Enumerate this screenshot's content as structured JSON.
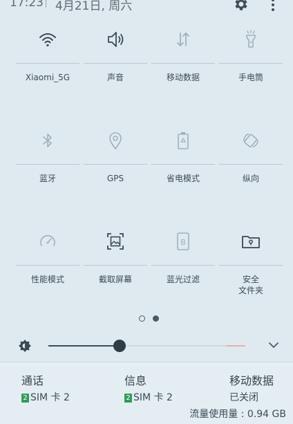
{
  "status_bar": {
    "time": "17:23",
    "date": "4月21日, 周六"
  },
  "tiles": [
    {
      "label": "Xiaomi_5G",
      "icon": "wifi-icon",
      "active": true
    },
    {
      "label": "声音",
      "icon": "speaker-icon",
      "active": true
    },
    {
      "label": "移动数据",
      "icon": "mobile-data-icon",
      "active": false
    },
    {
      "label": "手电筒",
      "icon": "flashlight-icon",
      "active": false
    },
    {
      "label": "蓝牙",
      "icon": "bluetooth-icon",
      "active": false
    },
    {
      "label": "GPS",
      "icon": "location-icon",
      "active": false
    },
    {
      "label": "省电模式",
      "icon": "battery-saver-icon",
      "active": false
    },
    {
      "label": "纵向",
      "icon": "auto-rotate-icon",
      "active": false
    },
    {
      "label": "性能模式",
      "icon": "speedometer-icon",
      "active": false
    },
    {
      "label": "截取屏幕",
      "icon": "screenshot-icon",
      "active": true
    },
    {
      "label": "蓝光过滤",
      "icon": "blue-light-filter-icon",
      "active": false
    },
    {
      "label": "安全\n文件夹",
      "icon": "secure-folder-icon",
      "active": true
    }
  ],
  "pager": {
    "current": 2,
    "total": 2
  },
  "brightness": {
    "level": 0.36,
    "icon": "brightness-icon"
  },
  "bottom": {
    "calls": {
      "title": "通话",
      "sim_badge": "2",
      "sim_text": "SIM 卡 2"
    },
    "messages": {
      "title": "信息",
      "sim_badge": "2",
      "sim_text": "SIM 卡 2"
    },
    "mobile_data": {
      "title": "移动数据",
      "status": "已关闭"
    },
    "usage": "流量使用量 : 0.94 GB"
  },
  "colors": {
    "background": "#dfeaf0",
    "active_icon": "#3a4750",
    "inactive_icon": "#9fb0ba",
    "sim_badge": "#2e9c5a"
  }
}
